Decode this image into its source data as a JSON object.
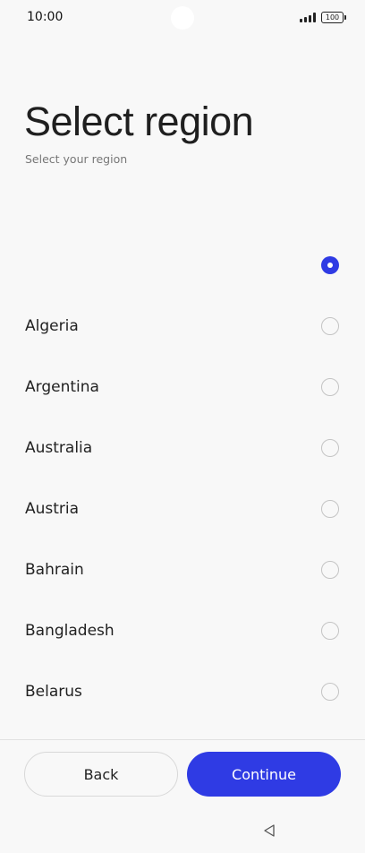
{
  "status_bar": {
    "time": "10:00",
    "battery_level": "100",
    "signal_icon": "signal-bars-icon",
    "battery_icon": "battery-icon"
  },
  "header": {
    "title": "Select region",
    "subtitle": "Select your region"
  },
  "regions": [
    {
      "label": "",
      "selected": true
    },
    {
      "label": "Algeria",
      "selected": false
    },
    {
      "label": "Argentina",
      "selected": false
    },
    {
      "label": "Australia",
      "selected": false
    },
    {
      "label": "Austria",
      "selected": false
    },
    {
      "label": "Bahrain",
      "selected": false
    },
    {
      "label": "Bangladesh",
      "selected": false
    },
    {
      "label": "Belarus",
      "selected": false
    }
  ],
  "footer": {
    "back_label": "Back",
    "continue_label": "Continue"
  },
  "colors": {
    "accent": "#2f3be4",
    "background": "#f8f8f8",
    "radio_border": "#c4c4c4"
  },
  "nav_bar": {
    "back_icon": "triangle-back-icon"
  }
}
